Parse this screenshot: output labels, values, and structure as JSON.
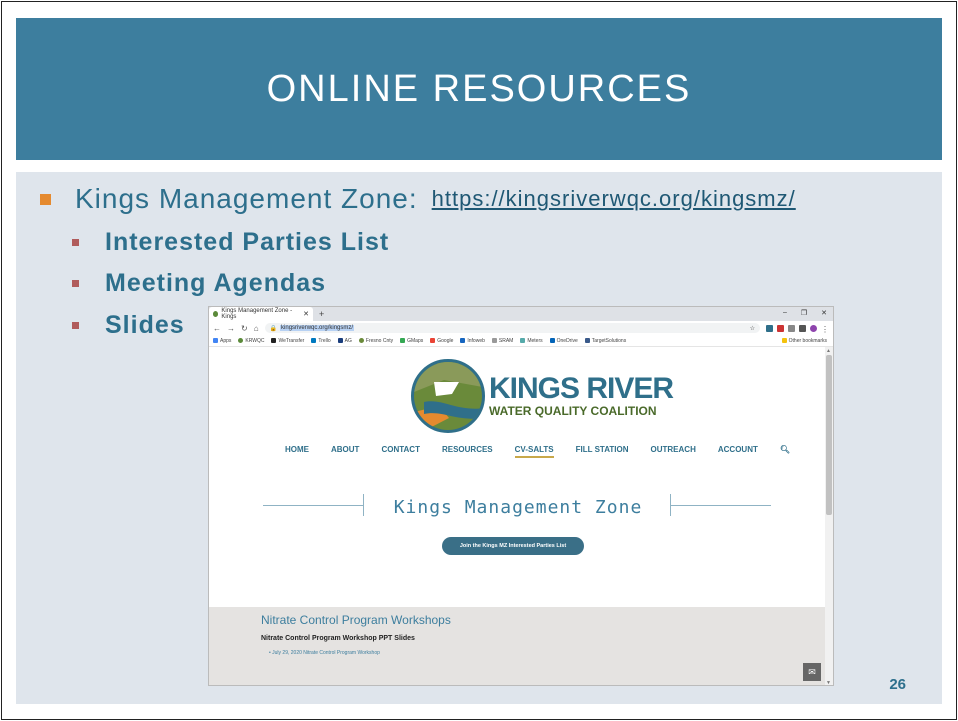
{
  "slide": {
    "title": "ONLINE RESOURCES",
    "page_number": "26",
    "main_bullet": {
      "label": "Kings Management Zone:",
      "link": "https://kingsriverwqc.org/kingsmz/"
    },
    "sub_bullets": [
      "Interested Parties List",
      "Meeting Agendas",
      "Slides"
    ]
  },
  "browser": {
    "tab_title": "Kings Management Zone - Kings",
    "new_tab": "+",
    "url": "kingsriverwqc.org/kingsmz/",
    "bookmarks": [
      "Apps",
      "KRWQC",
      "WeTransfer",
      "Trello",
      "AG",
      "Fresno Cnty",
      "GMaps",
      "Google",
      "Infoweb",
      "SRAM",
      "Meters",
      "OneDrive",
      "TargetSolutions"
    ],
    "other_bookmarks": "Other bookmarks",
    "page": {
      "logo_line1": "KINGS RIVER",
      "logo_line2": "WATER QUALITY COALITION",
      "nav": [
        "HOME",
        "ABOUT",
        "CONTACT",
        "RESOURCES",
        "CV-SALTS",
        "FILL STATION",
        "OUTREACH",
        "ACCOUNT"
      ],
      "active_nav": "CV-SALTS",
      "heading": "Kings Management Zone",
      "join_button": "Join the Kings MZ Interested Parties List",
      "workshops_title": "Nitrate Control Program Workshops",
      "workshops_subtitle": "Nitrate Control Program Workshop PPT Slides",
      "workshops_item": "July 29, 2020 Nitrate Control Program Workshop"
    }
  },
  "colors": {
    "title_bar": "#3d7e9e",
    "content_bg": "#dfe5ec",
    "bullet_orange": "#e58a2f",
    "bullet_red": "#b05b5b",
    "text_blue": "#2d6f8c"
  }
}
